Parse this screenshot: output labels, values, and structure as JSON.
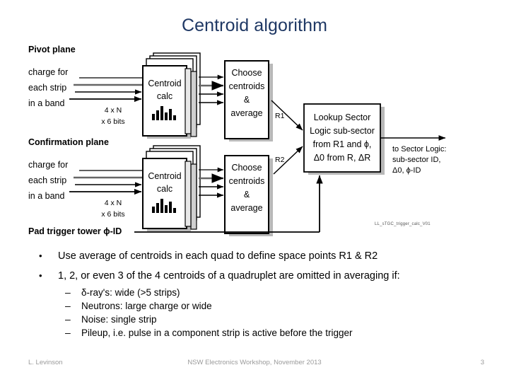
{
  "slide": {
    "title": "Centroid algorithm",
    "title_color": "#1F3864"
  },
  "diagram": {
    "credit": "LL_sTGC_trigger_calc_V01",
    "pivot": {
      "heading": "Pivot plane",
      "input_lines": [
        "charge for",
        "each strip",
        "in a band"
      ],
      "bits_line1": "4 x N",
      "bits_line2": "x 6 bits",
      "calc_box_line1": "Centroid",
      "calc_box_line2": "calc",
      "choose_box_line1": "Choose",
      "choose_box_line2": "centroids",
      "choose_box_line3": "&",
      "choose_box_line4": "average",
      "out_label": "R1"
    },
    "confirmation": {
      "heading": "Confirmation plane",
      "input_lines": [
        "charge for",
        "each strip",
        "in a band"
      ],
      "bits_line1": "4 x N",
      "bits_line2": "x 6 bits",
      "calc_box_line1": "Centroid",
      "calc_box_line2": "calc",
      "choose_box_line1": "Choose",
      "choose_box_line2": "centroids",
      "choose_box_line3": "&",
      "choose_box_line4": "average",
      "out_label": "R2"
    },
    "lookup": {
      "line1": "Lookup Sector",
      "line2": "Logic sub-sector",
      "line3": "from R1 and ϕ,",
      "line4": "Δ0 from R, ΔR"
    },
    "output": {
      "line1": "to Sector Logic:",
      "line2": "sub-sector ID,",
      "line3": "Δ0, ϕ-ID"
    },
    "pad_trigger_label": "Pad trigger tower ϕ-ID"
  },
  "bullets": [
    {
      "level": 1,
      "marker": "•",
      "text": "Use average of centroids in each quad to define space points R1 & R2"
    },
    {
      "level": 1,
      "marker": "•",
      "text": "1, 2, or even 3 of the 4 centroids of a quadruplet are omitted in averaging if:"
    },
    {
      "level": 2,
      "marker": "–",
      "text": "δ-ray's: wide (>5 strips)"
    },
    {
      "level": 2,
      "marker": "–",
      "text": "Neutrons: large charge or wide"
    },
    {
      "level": 2,
      "marker": "–",
      "text": "Noise: single strip"
    },
    {
      "level": 2,
      "marker": "–",
      "text": "Pileup, i.e. pulse in a component strip is active before the trigger"
    }
  ],
  "footer": {
    "author": "L. Levinson",
    "event": "NSW Electronics Workshop, November 2013",
    "page_number": "3"
  }
}
